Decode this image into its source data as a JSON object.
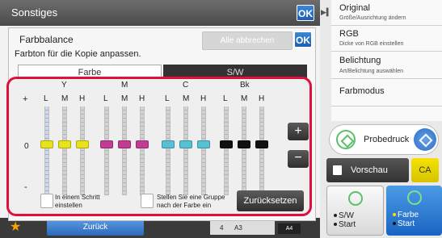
{
  "background": {
    "title": "Sonstiges",
    "ok_label": "OK"
  },
  "right_menu": [
    {
      "title": "Original",
      "subtitle": "Größe/Ausrichtung ändern"
    },
    {
      "title": "RGB",
      "subtitle": "Dicke von RGB einstellen"
    },
    {
      "title": "Belichtung",
      "subtitle": "Art/Belichtung auswählen"
    },
    {
      "title": "Farbmodus",
      "subtitle": ""
    }
  ],
  "actions": {
    "probedruck": "Probedruck",
    "vorschau": "Vorschau",
    "ca": "CA",
    "sw_start": [
      "S/W",
      "Start"
    ],
    "farbe_start": [
      "Farbe",
      "Start"
    ]
  },
  "footer": {
    "back": "Zurück",
    "paper_a": "4",
    "paper_b": "A3",
    "paper_c": "A4"
  },
  "dialog": {
    "title": "Farbbalance",
    "subtitle": "Farbton für die Kopie anpassen.",
    "cancel_all": "Alle abbrechen",
    "ok": "OK",
    "tabs": [
      {
        "label": "Farbe",
        "active": true
      },
      {
        "label": "S/W",
        "active": false
      }
    ],
    "scale": {
      "plus": "+",
      "zero": "0",
      "minus": "-"
    },
    "groups": [
      {
        "name": "Y",
        "color": "#e8e21a",
        "levels": [
          {
            "label": "L",
            "value": 0
          },
          {
            "label": "M",
            "value": 0
          },
          {
            "label": "H",
            "value": 0
          }
        ]
      },
      {
        "name": "M",
        "color": "#c23c93",
        "levels": [
          {
            "label": "L",
            "value": 0
          },
          {
            "label": "M",
            "value": 0
          },
          {
            "label": "H",
            "value": 0
          }
        ]
      },
      {
        "name": "C",
        "color": "#56c0d4",
        "levels": [
          {
            "label": "L",
            "value": 0
          },
          {
            "label": "M",
            "value": 0
          },
          {
            "label": "H",
            "value": 0
          }
        ]
      },
      {
        "name": "Bk",
        "color": "#111111",
        "levels": [
          {
            "label": "L",
            "value": 0
          },
          {
            "label": "M",
            "value": 0
          },
          {
            "label": "H",
            "value": 0
          }
        ]
      }
    ],
    "step_up": "+",
    "step_down": "−",
    "check_one_step": "In einem Schritt einstellen",
    "check_group": "Stellen Sie eine Gruppe nach der Farbe ein",
    "reset": "Zurücksetzen"
  },
  "colors": {
    "accent_blue": "#2c69bb",
    "highlight_red": "#e0103c",
    "ca_yellow": "#f6e200"
  }
}
